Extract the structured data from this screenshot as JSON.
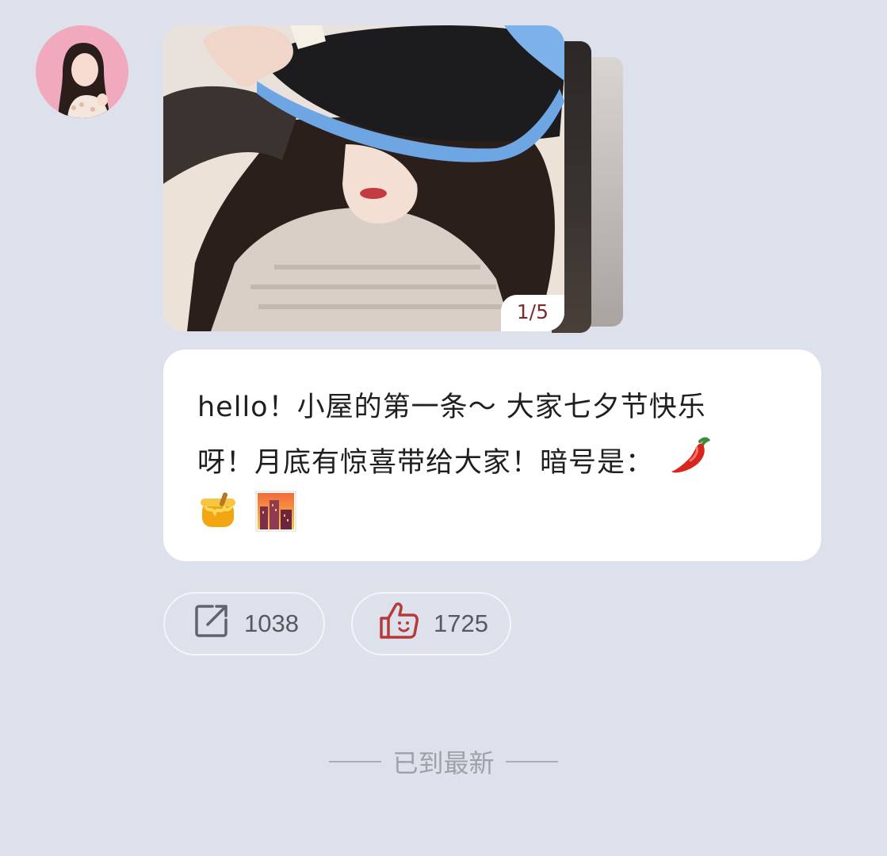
{
  "post": {
    "image_counter": "1/5",
    "text_line1": "hello！小屋的第一条～ 大家七夕节快乐",
    "text_line2": "呀！月底有惊喜带给大家！暗号是：",
    "emojis": [
      "chili-pepper",
      "honey-pot",
      "city-sunset"
    ]
  },
  "actions": {
    "share_count": "1038",
    "like_count": "1725"
  },
  "footer": {
    "latest_label": "已到最新"
  },
  "colors": {
    "background": "#dde1eb",
    "card": "#ffffff",
    "counter_text": "#7a2d2d",
    "like_icon": "#b63a3a"
  }
}
